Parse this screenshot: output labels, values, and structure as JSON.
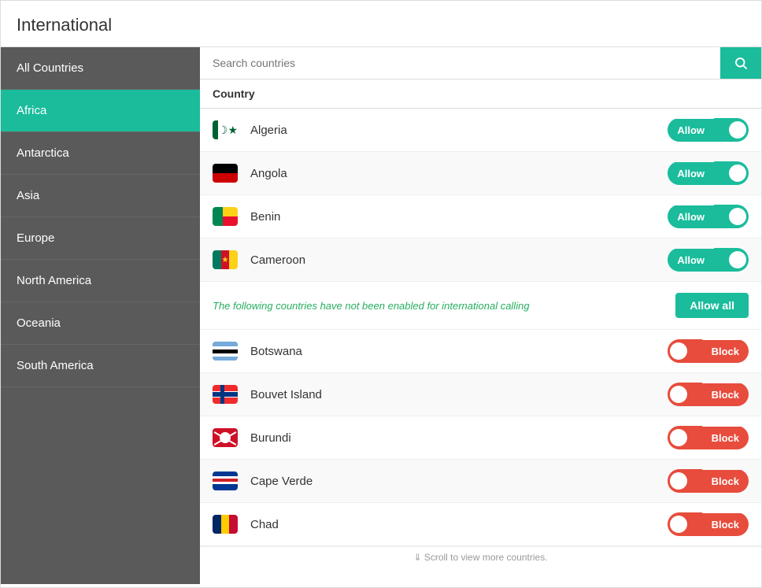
{
  "title": "International",
  "search": {
    "placeholder": "Search countries"
  },
  "sidebar": {
    "items": [
      {
        "id": "all-countries",
        "label": "All Countries",
        "active": false
      },
      {
        "id": "africa",
        "label": "Africa",
        "active": true
      },
      {
        "id": "antarctica",
        "label": "Antarctica",
        "active": false
      },
      {
        "id": "asia",
        "label": "Asia",
        "active": false
      },
      {
        "id": "europe",
        "label": "Europe",
        "active": false
      },
      {
        "id": "north-america",
        "label": "North America",
        "active": false
      },
      {
        "id": "oceania",
        "label": "Oceania",
        "active": false
      },
      {
        "id": "south-america",
        "label": "South America",
        "active": false
      }
    ]
  },
  "table": {
    "header": "Country",
    "allowed_countries": [
      {
        "id": "algeria",
        "name": "Algeria",
        "flag": "algeria",
        "status": "Allow"
      },
      {
        "id": "angola",
        "name": "Angola",
        "flag": "angola",
        "status": "Allow"
      },
      {
        "id": "benin",
        "name": "Benin",
        "flag": "benin",
        "status": "Allow"
      },
      {
        "id": "cameroon",
        "name": "Cameroon",
        "flag": "cameroon",
        "status": "Allow"
      }
    ],
    "divider_text": "The following countries have not been enabled for international calling",
    "allow_all_label": "Allow all",
    "blocked_countries": [
      {
        "id": "botswana",
        "name": "Botswana",
        "flag": "botswana",
        "status": "Block"
      },
      {
        "id": "bouvet-island",
        "name": "Bouvet Island",
        "flag": "norway",
        "status": "Block"
      },
      {
        "id": "burundi",
        "name": "Burundi",
        "flag": "burundi",
        "status": "Block"
      },
      {
        "id": "cape-verde",
        "name": "Cape Verde",
        "flag": "capeverde",
        "status": "Block"
      },
      {
        "id": "chad",
        "name": "Chad",
        "flag": "chad",
        "status": "Block"
      }
    ],
    "scroll_hint": "⇓ Scroll to view more countries."
  },
  "icons": {
    "search": "🔍"
  }
}
